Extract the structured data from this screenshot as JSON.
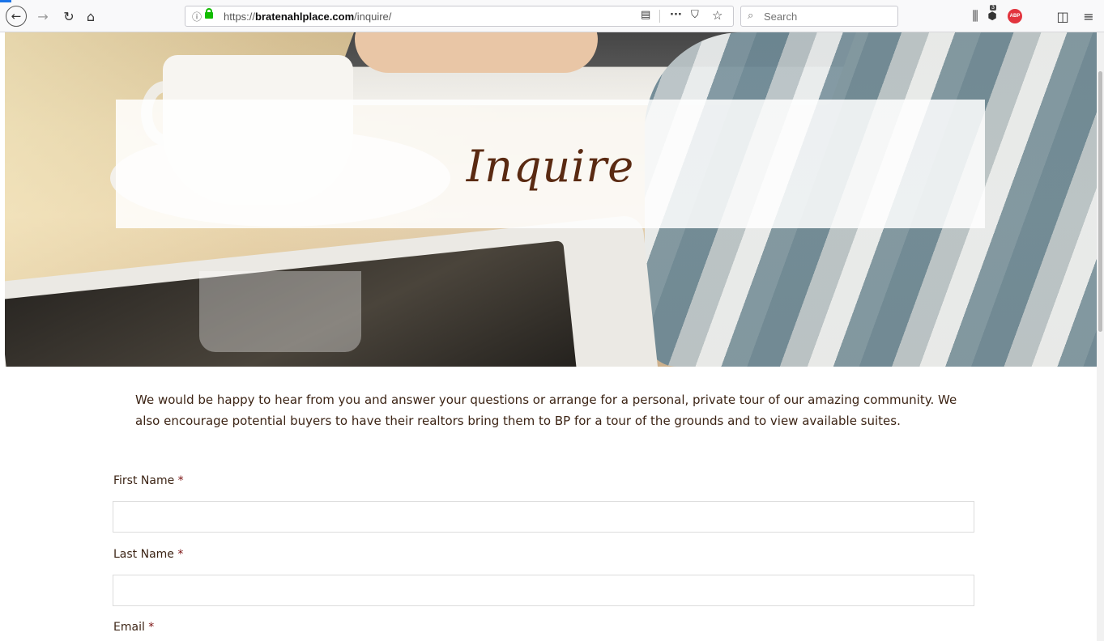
{
  "browser": {
    "url_prefix": "https://",
    "url_domain": "bratenahlplace.com",
    "url_path": "/inquire/",
    "search_placeholder": "Search",
    "info_icon": "ⓘ",
    "back_icon": "←",
    "forward_icon": "→",
    "reload_icon": "↻",
    "home_icon": "⌂",
    "reader_icon": "▤",
    "more_icon": "···",
    "pocket_icon": "⛉",
    "bookmark_icon": "☆",
    "search_icon_glyph": "⌕",
    "library_icon": "⫼",
    "extension_badge": "3",
    "abp_label": "ABP",
    "sidebar_icon": "◫",
    "menu_icon": "≡"
  },
  "hero": {
    "title": "Inquire"
  },
  "intro": {
    "text": "We would be happy to hear from you and answer your questions or arrange for a personal, private tour of our amazing community. We also encourage potential buyers to have their realtors bring them to BP for a tour of the grounds and to view available suites."
  },
  "form": {
    "first_name_label": "First Name",
    "last_name_label": "Last Name",
    "email_label": "Email",
    "required_marker": "*",
    "first_name_value": "",
    "last_name_value": ""
  },
  "colors": {
    "title_color": "#5a2a12",
    "text_color": "#3c2415",
    "required_color": "#7a1010",
    "lock_color": "#12bc00"
  }
}
